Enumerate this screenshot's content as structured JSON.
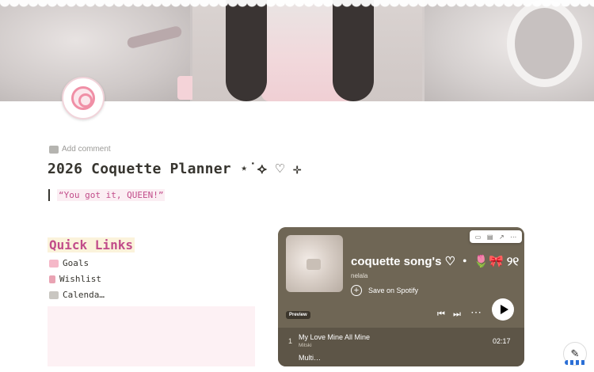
{
  "page": {
    "title": "2026 Coquette Planner ⋆˙⟡ ♡ ⊹",
    "add_comment": "Add comment",
    "quote": "“You got it, QUEEN!”"
  },
  "quick_links": {
    "heading": "Quick Links",
    "items": [
      {
        "label": "Goals",
        "icon": "pink-ribbon-icon",
        "color": "#f5b8c8"
      },
      {
        "label": "Wishlist",
        "icon": "lipstick-icon",
        "color": "#e9a3b3"
      },
      {
        "label": "Calenda…",
        "icon": "calendar-icon",
        "color": "#c9c6c1"
      }
    ]
  },
  "spotify": {
    "playlist_title": "coquette song's ♡ ・ 🌷🎀 ୨୧ ・",
    "owner": "nelala",
    "save_label": "Save on Spotify",
    "preview_label": "Preview",
    "tracks": [
      {
        "number": "1",
        "name": "My Love Mine All Mine",
        "artist": "Mitski",
        "duration": "02:17"
      },
      {
        "number": "",
        "name": "Multi…",
        "artist": "",
        "duration": ""
      }
    ],
    "bg_color": "#6f6655"
  },
  "colors": {
    "accent_pink": "#c14c8a",
    "highlight_yellow": "#fbf3db",
    "highlight_pink": "#fbeef3"
  }
}
